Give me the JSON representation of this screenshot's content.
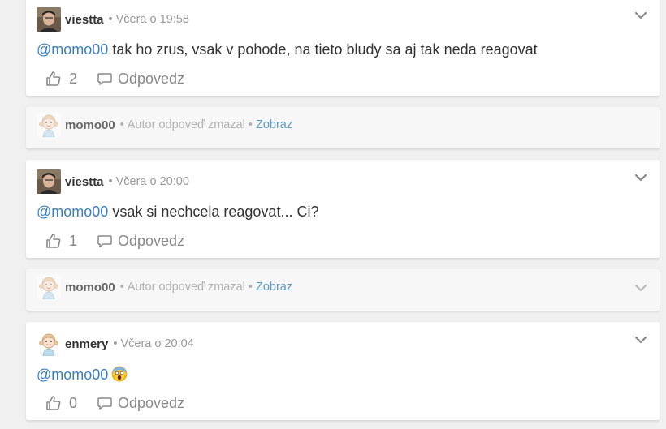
{
  "comments": [
    {
      "author": "viestta",
      "time": "Včera o 19:58",
      "mention": "@momo00",
      "text": "tak ho zrus, vsak v pohode, na tieto bludy sa aj tak neda reagovat",
      "likes": "2",
      "reply_label": "Odpovedz",
      "avatar": "photo-avatar"
    },
    {
      "author": "momo00",
      "status": "Autor odpoveď zmazal",
      "show_label": "Zobraz",
      "avatar": "cartoon-girl-avatar"
    },
    {
      "author": "viestta",
      "time": "Včera o 20:00",
      "mention": "@momo00",
      "text": "vsak si nechcela reagovat... Ci?",
      "likes": "1",
      "reply_label": "Odpovedz",
      "avatar": "photo-avatar"
    },
    {
      "author": "momo00",
      "status": "Autor odpoveď zmazal",
      "show_label": "Zobraz",
      "avatar": "cartoon-girl-avatar"
    },
    {
      "author": "enmery",
      "time": "Včera o 20:04",
      "mention": "@momo00",
      "text": "",
      "emoji": "face-screaming-in-fear",
      "likes": "0",
      "reply_label": "Odpovedz",
      "avatar": "cartoon-girl-avatar"
    }
  ],
  "separator": "•",
  "colors": {
    "mention": "#3a7fc1",
    "link": "#5b9bc9",
    "muted": "#999999",
    "background": "#f0f0f0"
  }
}
